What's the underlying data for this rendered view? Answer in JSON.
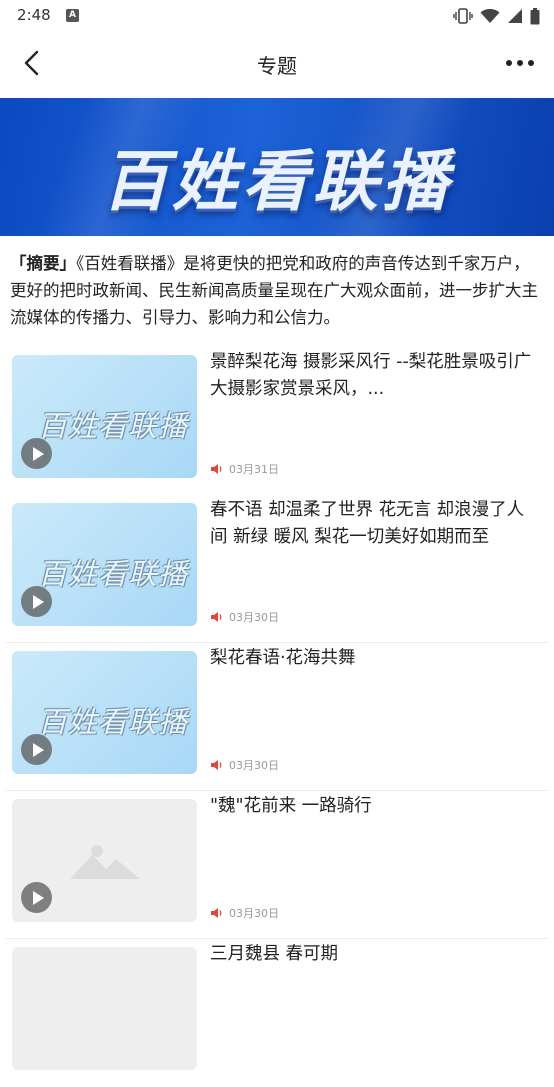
{
  "status_bar": {
    "time": "2:48",
    "app_icon": "A"
  },
  "header": {
    "title": "专题",
    "back_icon": "chevron-left-icon",
    "more_icon": "more-dots-icon"
  },
  "banner": {
    "text": "百姓看联播"
  },
  "summary": {
    "label": "「摘要」",
    "text": "《百姓看联播》是将更快的把党和政府的声音传达到千家万户，更好的把时政新闻、民生新闻高质量呈现在广大观众面前，进一步扩大主流媒体的传播力、引导力、影响力和公信力。"
  },
  "items": [
    {
      "title": "景醉梨花海 摄影采风行 --梨花胜景吸引广大摄影家赏景采风，...",
      "date": "03月31日",
      "thumb_text": "百姓看联播",
      "has_image": true
    },
    {
      "title": "春不语 却温柔了世界 花无言 却浪漫了人间 新绿 暖风 梨花一切美好如期而至",
      "date": "03月30日",
      "thumb_text": "百姓看联播",
      "has_image": true
    },
    {
      "title": "梨花春语·花海共舞",
      "date": "03月30日",
      "thumb_text": "百姓看联播",
      "has_image": true
    },
    {
      "title": "\"魏\"花前来 一路骑行",
      "date": "03月30日",
      "thumb_text": "",
      "has_image": false
    },
    {
      "title": "三月魏县 春可期",
      "date": "",
      "thumb_text": "",
      "has_image": false
    }
  ],
  "colors": {
    "banner_blue": "#1552c9",
    "speaker_red": "#e0463a"
  }
}
